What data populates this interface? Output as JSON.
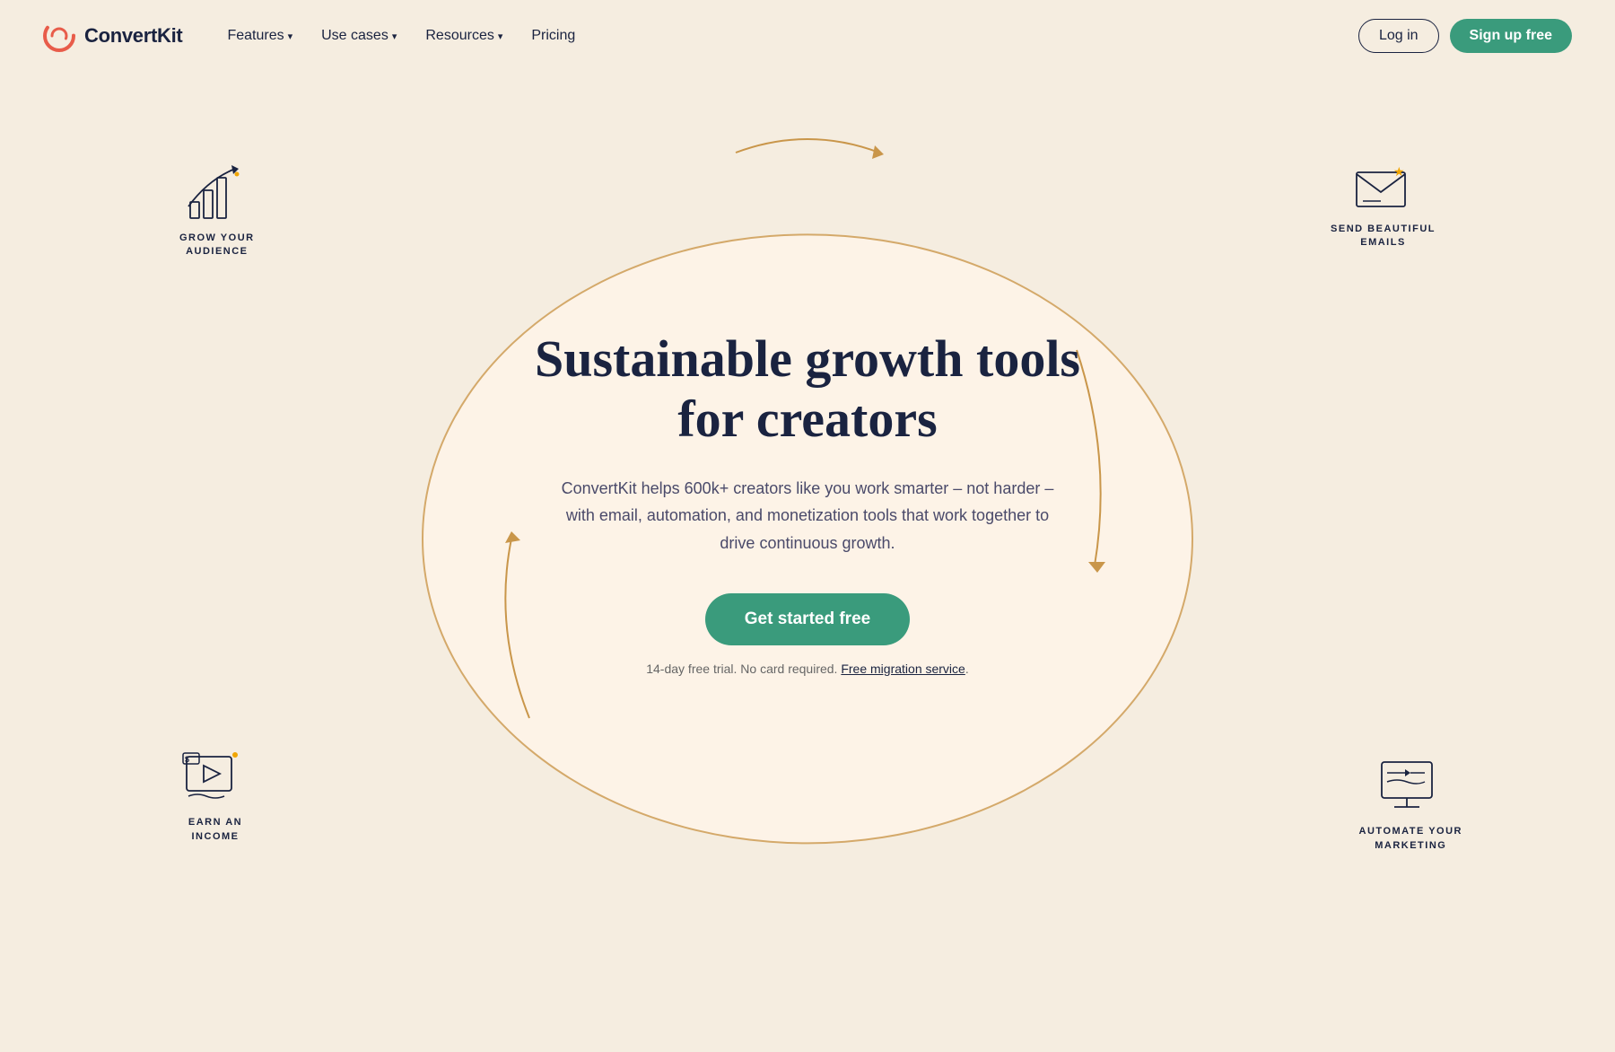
{
  "nav": {
    "logo_text": "ConvertKit",
    "links": [
      {
        "label": "Features",
        "has_dropdown": true
      },
      {
        "label": "Use cases",
        "has_dropdown": true
      },
      {
        "label": "Resources",
        "has_dropdown": true
      },
      {
        "label": "Pricing",
        "has_dropdown": false
      }
    ],
    "login_label": "Log in",
    "signup_label": "Sign up free"
  },
  "hero": {
    "title_line1": "Sustainable growth tools",
    "title_line2": "for creators",
    "subtitle": "ConvertKit helps 600k+ creators like you work smarter – not harder – with email, automation, and monetization tools that work together to drive continuous growth.",
    "cta_label": "Get started free",
    "trial_text": "14-day free trial. No card required.",
    "migration_label": "Free migration service"
  },
  "icons": {
    "grow": {
      "label_line1": "GROW YOUR",
      "label_line2": "AUDIENCE"
    },
    "email": {
      "label_line1": "SEND BEAUTIFUL",
      "label_line2": "EMAILS"
    },
    "earn": {
      "label_line1": "EARN AN",
      "label_line2": "INCOME"
    },
    "automate": {
      "label_line1": "AUTOMATE YOUR",
      "label_line2": "MARKETING"
    }
  },
  "colors": {
    "brand_green": "#3a9b7c",
    "brand_navy": "#1a2340",
    "brand_orange": "#e85c4a",
    "bg": "#f5ede0",
    "oval_bg": "#fdf3e7",
    "arrow_color": "#c9964a"
  }
}
